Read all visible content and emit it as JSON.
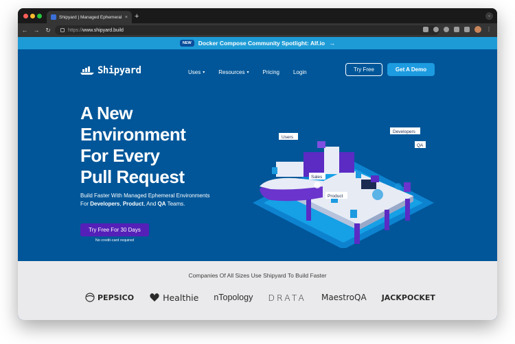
{
  "browser": {
    "tab_title": "Shipyard | Managed Ephemeral",
    "tab_close": "×",
    "new_tab": "+",
    "url_protocol": "https://",
    "url_host": "www.shipyard.build"
  },
  "announcement": {
    "badge": "NEW",
    "text": "Docker Compose Community Spotlight: Alf.io",
    "arrow": "→"
  },
  "nav": {
    "logo_text": "Shipyard",
    "links": [
      {
        "label": "Uses",
        "caret": "▾"
      },
      {
        "label": "Resources",
        "caret": "▾"
      },
      {
        "label": "Pricing"
      },
      {
        "label": "Login"
      }
    ],
    "try_free": "Try Free",
    "get_demo": "Get A Demo"
  },
  "hero": {
    "title_lines": [
      "A New",
      "Environment",
      "For Every",
      "Pull Request"
    ],
    "subtitle_pre": "Build Faster With Managed Ephemeral Environments For ",
    "subtitle_b1": "Developers",
    "subtitle_mid1": ", ",
    "subtitle_b2": "Product",
    "subtitle_mid2": ", And ",
    "subtitle_b3": "QA",
    "subtitle_post": " Teams.",
    "cta": "Try Free For 30 Days",
    "cta_note": "No credit-card required"
  },
  "illustration": {
    "labels": [
      "Users",
      "Developers",
      "QA",
      "Sales",
      "Product"
    ]
  },
  "logos": {
    "heading": "Companies Of All Sizes Use Shipyard To Build Faster",
    "brands": [
      "PEPSICO",
      "Healthie",
      "nTopology",
      "DRATA",
      "MaestroQA",
      "JACKPOCKET"
    ]
  },
  "colors": {
    "hero_bg": "#005699",
    "announcement_bg": "#1d9bd6",
    "demo_button": "#1d9be0",
    "cta_button": "#5420b8",
    "logos_bg": "#eaeaec"
  }
}
